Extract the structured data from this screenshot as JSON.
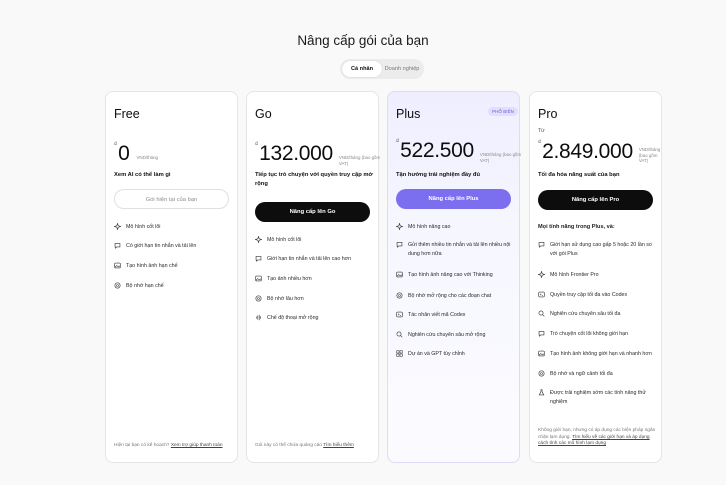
{
  "page": {
    "title": "Nâng cấp gói của bạn"
  },
  "segment": {
    "personal": "Cá nhân",
    "business": "Doanh nghiệp"
  },
  "plans": [
    {
      "name": "Free",
      "currency": "₫",
      "amount": "0",
      "unit": "VND/tháng",
      "tagline": "Xem AI có thể làm gì",
      "cta": "Gói hiện tại của bạn",
      "features": [
        {
          "icon": "sparkle-icon",
          "text": "Mô hình cốt lõi"
        },
        {
          "icon": "chat-icon",
          "text": "Có giới hạn tin nhắn và tải lên"
        },
        {
          "icon": "image-icon",
          "text": "Tạo hình ảnh hạn chế"
        },
        {
          "icon": "memory-icon",
          "text": "Bộ nhớ hạn chế"
        }
      ],
      "footer_text": "Hiện tại bạn có kế hoạch?",
      "footer_link": "Xem trợ giúp thanh toán"
    },
    {
      "name": "Go",
      "currency": "₫",
      "amount": "132.000",
      "unit": "VND/tháng (bao gồm VAT)",
      "tagline": "Tiếp tục trò chuyện với quyền truy cập mở rộng",
      "cta": "Nâng cấp lên Go",
      "features": [
        {
          "icon": "sparkle-icon",
          "text": "Mô hình cốt lõi"
        },
        {
          "icon": "chat-icon",
          "text": "Giới hạn tin nhắn và tải lên cao hơn"
        },
        {
          "icon": "image-icon",
          "text": "Tạo ảnh nhiều hơn"
        },
        {
          "icon": "memory-icon",
          "text": "Bộ nhớ lâu hơn"
        },
        {
          "icon": "voice-icon",
          "text": "Chế độ thoại mở rộng"
        }
      ],
      "footer_text": "Gói này có thể chứa quảng cáo",
      "footer_link": "Tìm hiểu thêm"
    },
    {
      "name": "Plus",
      "badge": "PHỔ BIẾN",
      "currency": "₫",
      "amount": "522.500",
      "unit": "VND/tháng (bao gồm VAT)",
      "tagline": "Tận hưởng trải nghiệm đầy đủ",
      "cta": "Nâng cấp lên Plus",
      "features": [
        {
          "icon": "sparkle-icon",
          "text": "Mô hình nâng cao"
        },
        {
          "icon": "chat-icon",
          "text": "Gửi thêm nhiều tin nhắn và tải lên nhiều nội dung hơn nữa"
        },
        {
          "icon": "image-icon",
          "text": "Tạo hình ảnh nâng cao với Thinking"
        },
        {
          "icon": "memory-icon",
          "text": "Bộ nhớ mở rộng cho các đoạn chat"
        },
        {
          "icon": "codex-icon",
          "text": "Tác nhân viết mã Codex"
        },
        {
          "icon": "research-icon",
          "text": "Nghiên cứu chuyên sâu mở rộng"
        },
        {
          "icon": "gpt-icon",
          "text": "Dự án và GPT tùy chỉnh"
        }
      ]
    },
    {
      "name": "Pro",
      "prefix": "Từ",
      "currency": "₫",
      "amount": "2.849.000",
      "unit": "VND/tháng (bao gồm VAT)",
      "tagline": "Tối đa hóa năng suất của bạn",
      "cta": "Nâng cấp lên Pro",
      "section_title": "Mọi tính năng trong Plus, và:",
      "features": [
        {
          "icon": "chat-icon",
          "text": "Giới hạn sử dụng cao gấp 5 hoặc 20 lần so với gói Plus"
        },
        {
          "icon": "sparkle-icon",
          "text": "Mô hình Frontier Pro"
        },
        {
          "icon": "codex-icon",
          "text": "Quyền truy cập tối đa vào Codex"
        },
        {
          "icon": "research-icon",
          "text": "Nghiên cứu chuyên sâu tối đa"
        },
        {
          "icon": "chat-icon",
          "text": "Trò chuyện cốt lõi không giới hạn"
        },
        {
          "icon": "image-icon",
          "text": "Tạo hình ảnh không giới hạn và nhanh hơn"
        },
        {
          "icon": "memory-icon",
          "text": "Bộ nhớ và ngữ cảnh tối đa"
        },
        {
          "icon": "flask-icon",
          "text": "Được trải nghiệm sớm các tính năng thử nghiệm"
        }
      ],
      "footer_text": "Không giới hạn, nhưng có áp dụng các biện pháp ngăn chặn lạm dụng.",
      "footer_link": "Tìm hiểu về các giới hạn và áp dụng cách tính các mô hình lạm dụng"
    }
  ]
}
